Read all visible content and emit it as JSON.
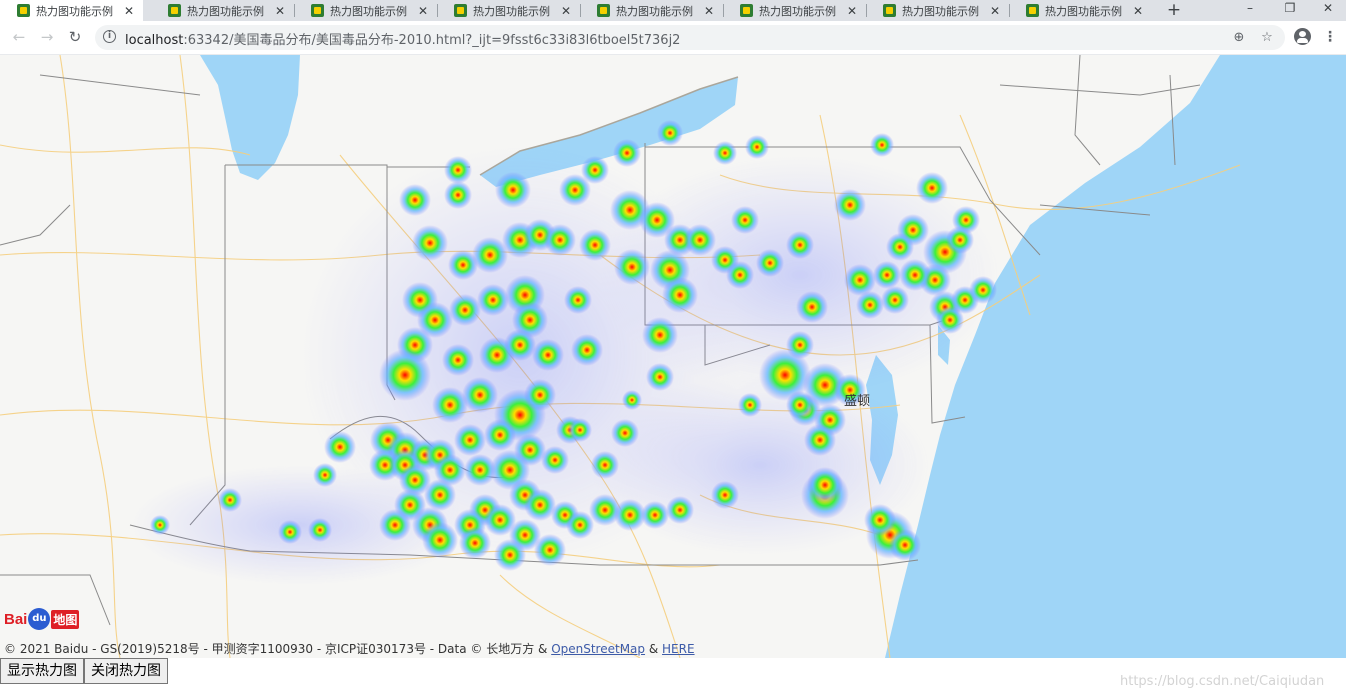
{
  "browser": {
    "tabs": [
      {
        "title": "热力图功能示例",
        "active": true
      },
      {
        "title": "热力图功能示例",
        "active": false
      },
      {
        "title": "热力图功能示例",
        "active": false
      },
      {
        "title": "热力图功能示例",
        "active": false
      },
      {
        "title": "热力图功能示例",
        "active": false
      },
      {
        "title": "热力图功能示例",
        "active": false
      },
      {
        "title": "热力图功能示例",
        "active": false
      },
      {
        "title": "热力图功能示例",
        "active": false
      }
    ],
    "new_tab_label": "+",
    "window_controls": {
      "minimize": "–",
      "restore": "❐",
      "close": "✕"
    },
    "address": {
      "host": "localhost",
      "rest": ":63342/美国毒品分布/美国毒品分布-2010.html?_ijt=9fsst6c33i83l6tboel5t736j2"
    },
    "icons": [
      "back-icon",
      "forward-icon",
      "reload-icon",
      "info-icon",
      "zoom-icon",
      "bookmark-star-icon",
      "profile-icon",
      "menu-icon"
    ]
  },
  "map": {
    "city_label": "盛顿",
    "logo": {
      "bai": "Bai",
      "du": "du",
      "map_word": "地图"
    },
    "copyright_text": "© 2021 Baidu - GS(2019)5218号 - 甲测资字1100930 - 京ICP证030173号 - Data © 长地万方 & ",
    "attribution_link_1": "OpenStreetMap",
    "attribution_sep": " & ",
    "attribution_link_2": "HERE",
    "colors": {
      "water": "#9fd5f7",
      "land": "#f6f6f4",
      "road": "#f5cf7f",
      "border": "#888888"
    }
  },
  "controls": {
    "show_heatmap": "显示热力图",
    "hide_heatmap": "关闭热力图"
  },
  "watermark": "https://blog.csdn.net/Caiqiudan"
}
